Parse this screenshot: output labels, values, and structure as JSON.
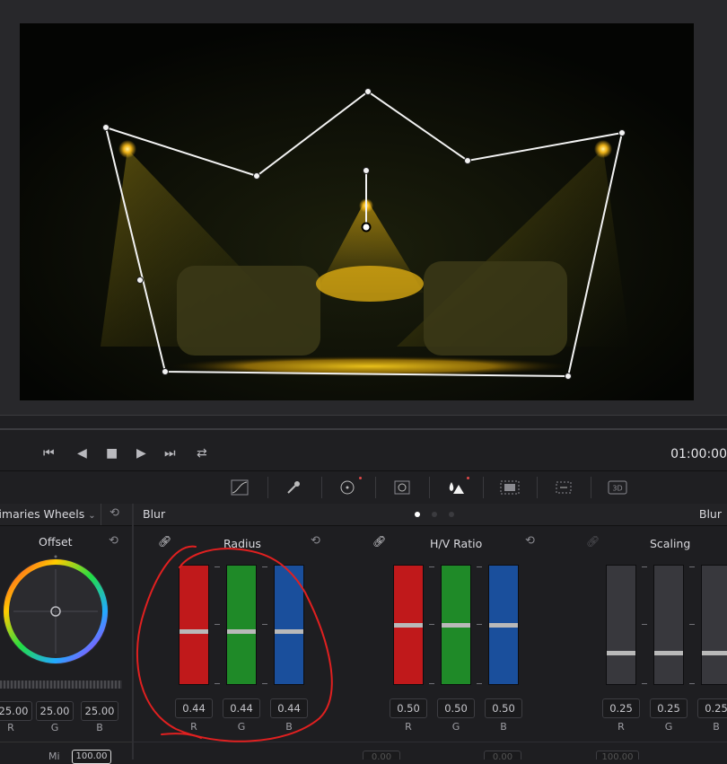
{
  "transport": {
    "timecode": "01:00:00",
    "icons": [
      "skip-back-icon",
      "step-back-icon",
      "stop-icon",
      "play-icon",
      "skip-forward-icon",
      "loop-icon"
    ]
  },
  "toolbar": {
    "icons": [
      "curves-icon",
      "qualifier-icon",
      "power-window-icon",
      "tracker-icon",
      "blur-icon",
      "key-icon",
      "sizing-icon",
      "3d-icon"
    ],
    "three_d_label": "3D"
  },
  "left_panel": {
    "mode_label": "Primaries Wheels",
    "wheel_title": "Offset",
    "values": [
      {
        "value": "25.00",
        "channel": "R"
      },
      {
        "value": "25.00",
        "channel": "G"
      },
      {
        "value": "25.00",
        "channel": "B"
      }
    ],
    "bottom_label": "Mi",
    "bottom_value": "100.00"
  },
  "blur_panel": {
    "header_left": "Blur",
    "header_right": "Blur",
    "groups": [
      {
        "title": "Radius",
        "linked": true,
        "sliders": [
          {
            "channel": "R",
            "value": "0.44",
            "level": 0.44,
            "color": "#c0191b"
          },
          {
            "channel": "G",
            "value": "0.44",
            "level": 0.44,
            "color": "#1f8a28"
          },
          {
            "channel": "B",
            "value": "0.44",
            "level": 0.44,
            "color": "#1a4f9c"
          }
        ]
      },
      {
        "title": "H/V Ratio",
        "linked": true,
        "sliders": [
          {
            "channel": "R",
            "value": "0.50",
            "level": 0.5,
            "color": "#c0191b"
          },
          {
            "channel": "G",
            "value": "0.50",
            "level": 0.5,
            "color": "#1f8a28"
          },
          {
            "channel": "B",
            "value": "0.50",
            "level": 0.5,
            "color": "#1a4f9c"
          }
        ]
      },
      {
        "title": "Scaling",
        "linked": false,
        "sliders": [
          {
            "channel": "R",
            "value": "0.25",
            "level": 0.25,
            "color": "#38383d"
          },
          {
            "channel": "G",
            "value": "0.25",
            "level": 0.25,
            "color": "#38383d"
          },
          {
            "channel": "B",
            "value": "0.25",
            "level": 0.25,
            "color": "#38383d"
          }
        ]
      }
    ],
    "bottom_partial_values": [
      "0.00",
      "0.00",
      "100.00"
    ]
  },
  "annotation": {
    "color": "#e02020"
  }
}
